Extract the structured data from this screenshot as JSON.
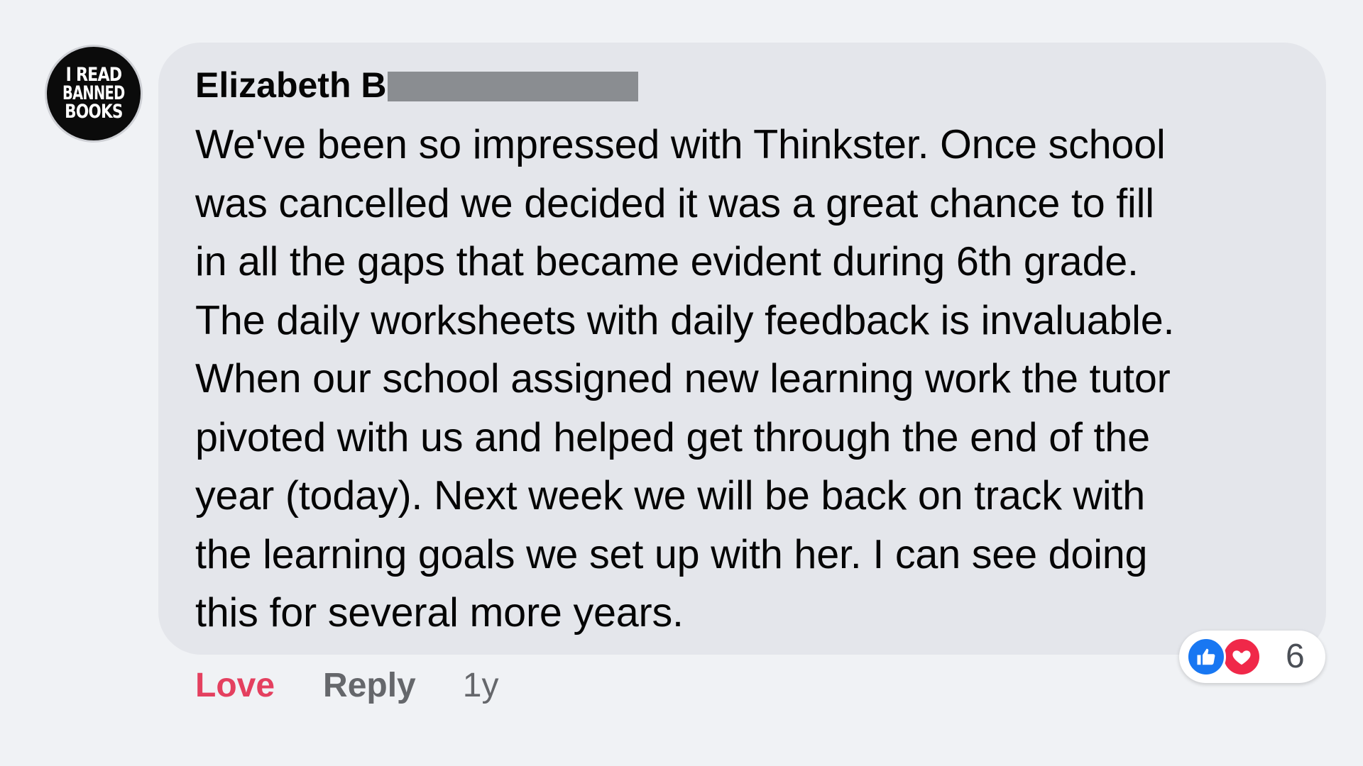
{
  "comment": {
    "avatar": {
      "lines": [
        "I READ",
        "BANNED",
        "BOOKS"
      ]
    },
    "author": "Elizabeth B",
    "text": "We've been so impressed with Thinkster. Once school\nwas cancelled we decided it was a great chance to fill\nin all the gaps that became evident during 6th grade.\nThe daily worksheets with daily feedback is invaluable.\nWhen our school assigned new learning work the tutor\npivoted with us and helped get through the end of the\nyear (today). Next week we will be back on track with\nthe learning goals we set up with her. I can see doing\nthis for several more years.",
    "reactions": {
      "icons": [
        "like-icon",
        "heart-icon"
      ],
      "count": "6"
    },
    "actions": {
      "love_label": "Love",
      "reply_label": "Reply",
      "timestamp": "1y"
    }
  },
  "colors": {
    "bubble": "#e4e6eb",
    "love": "#e4405f",
    "like": "#1877f2",
    "heart": "#f02849",
    "secondary_text": "#65676b"
  }
}
